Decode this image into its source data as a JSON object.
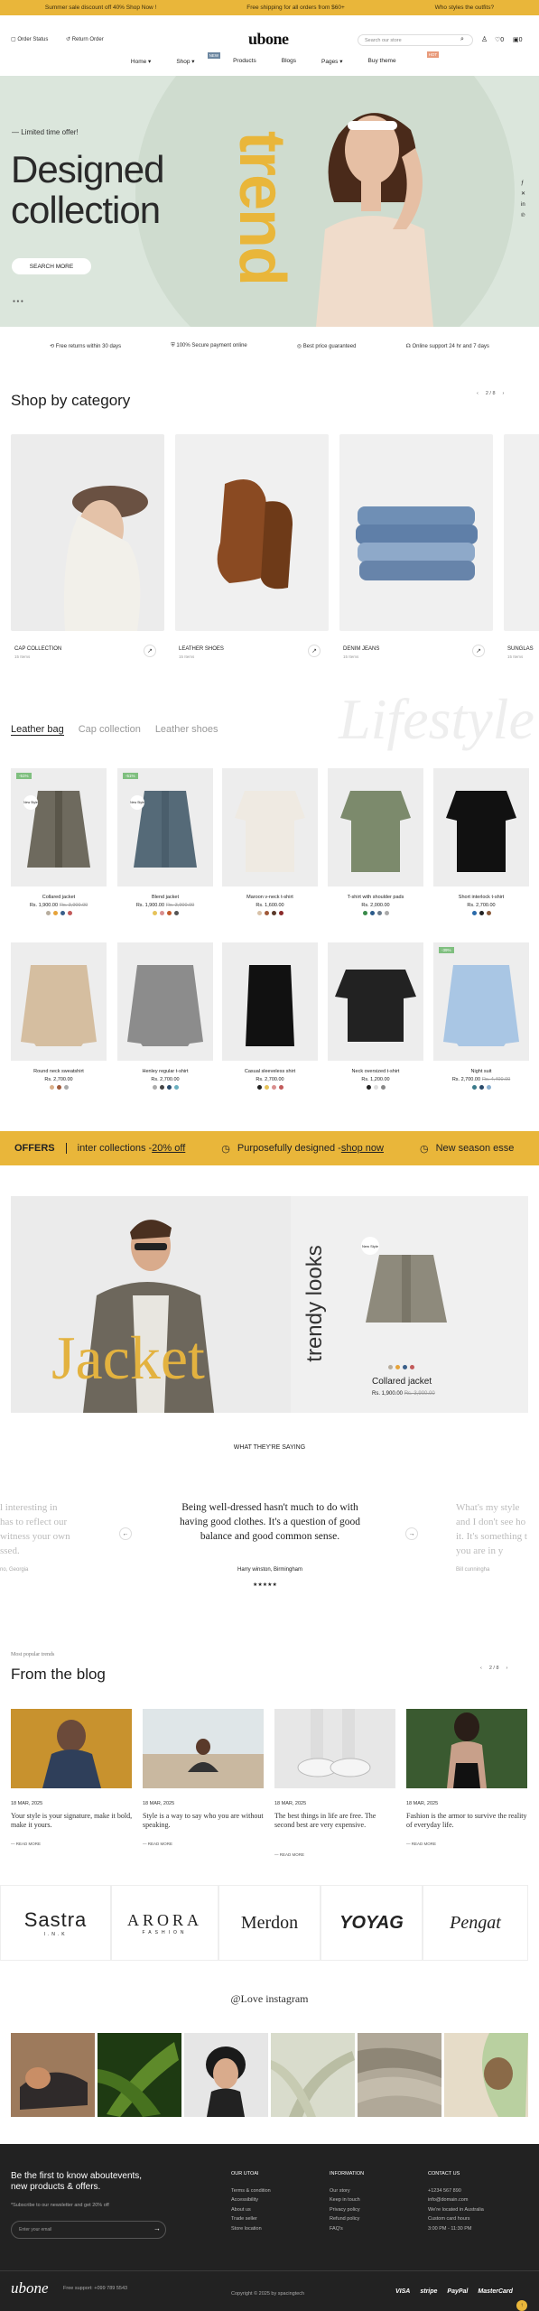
{
  "announcement": [
    "Summer sale discount off 40% Shop Now !",
    "Free shipping for all orders from $60+",
    "Who styles the outfits?"
  ],
  "header": {
    "order_status": "Order Status",
    "return_order": "Return Order",
    "logo": "ubone",
    "search_placeholder": "Search our store",
    "wish_count": "0",
    "cart_count": "0"
  },
  "nav": {
    "items": [
      "Home",
      "Shop",
      "Products",
      "Blogs",
      "Pages",
      "Buy theme"
    ],
    "shop_badge": "NEW",
    "buy_badge": "HOT"
  },
  "hero": {
    "kicker": "Limited time offer!",
    "title1": "Designed",
    "title2": "collection",
    "cta": "SEARCH MORE",
    "vertical": "trend"
  },
  "features": [
    "Free returns within 30 days",
    "100% Secure payment online",
    "Best price guaranteed",
    "Online support 24 hr and 7 days"
  ],
  "category": {
    "title": "Shop by category",
    "pager": "2 / 8",
    "items": [
      {
        "name": "CAP COLLECTION",
        "sub": "15 Items"
      },
      {
        "name": "LEATHER SHOES",
        "sub": "15 Items"
      },
      {
        "name": "DENIM JEANS",
        "sub": "15 Items"
      },
      {
        "name": "SUNGLAS",
        "sub": "15 Items"
      }
    ]
  },
  "tabs": {
    "items": [
      "Leather bag",
      "Cap collection",
      "Leather shoes"
    ],
    "bg_word": "Lifestyle"
  },
  "products": [
    {
      "name": "Collared jacket",
      "price": "Rs. 1,900.00",
      "old": "Rs. 3,900.00",
      "sale": "-51%",
      "badge": "New Style",
      "sw": [
        "#b7ad9e",
        "#e6a33a",
        "#3a5f8a",
        "#c25a5a"
      ]
    },
    {
      "name": "Blend jacket",
      "price": "Rs. 1,900.00",
      "old": "Rs. 3,900.00",
      "sale": "-51%",
      "badge": "New Style",
      "sw": [
        "#e6c35a",
        "#d98e8e",
        "#c25a2a",
        "#555"
      ]
    },
    {
      "name": "Maroon v-neck t-shirt",
      "price": "Rs. 1,600.00",
      "old": "",
      "sale": "",
      "badge": "",
      "sw": [
        "#d9c2a8",
        "#a05a3a",
        "#5a3a2a",
        "#8a2a2a"
      ]
    },
    {
      "name": "T-shirt with shoulder pads",
      "price": "Rs. 2,000.00",
      "old": "",
      "sale": "",
      "badge": "",
      "sw": [
        "#3a8a4a",
        "#2a5a8a",
        "#6a7a8a",
        "#aaa"
      ]
    },
    {
      "name": "Short interlock t-shirt",
      "price": "Rs. 2,700.00",
      "old": "",
      "sale": "",
      "badge": "",
      "sw": [
        "#2a6aaa",
        "#222",
        "#8a5a3a"
      ]
    },
    {
      "name": "Round neck sweatshirt",
      "price": "Rs. 2,700.00",
      "old": "",
      "sale": "",
      "badge": "",
      "sw": [
        "#d9b08a",
        "#a05a3a",
        "#aaa"
      ]
    },
    {
      "name": "Henley regular t-shirt",
      "price": "Rs. 2,700.00",
      "old": "",
      "sale": "",
      "badge": "",
      "sw": [
        "#aaa",
        "#444",
        "#2a4a6a",
        "#6ab0c0"
      ]
    },
    {
      "name": "Casual sleeveless shirt",
      "price": "Rs. 2,700.00",
      "old": "",
      "sale": "",
      "badge": "",
      "sw": [
        "#222",
        "#e6c35a",
        "#d98e8e",
        "#c25a5a"
      ]
    },
    {
      "name": "Neck oversized t-shirt",
      "price": "Rs. 1,200.00",
      "old": "",
      "sale": "",
      "badge": "",
      "sw": [
        "#222",
        "#ddd",
        "#888"
      ]
    },
    {
      "name": "Night suit",
      "price": "Rs. 2,700.00",
      "old": "Rs. 4,400.00",
      "sale": "-39%",
      "badge": "",
      "sw": [
        "#3a7a8a",
        "#2a4a6a",
        "#8ab0d0"
      ]
    }
  ],
  "marquee": {
    "offers": "OFFERS",
    "t1": "inter collections - ",
    "l1": "20% off",
    "t2": "Purposefully designed - ",
    "l2": "shop now",
    "t3": "New season esse"
  },
  "banner": {
    "jacket": "Jacket",
    "vertical": "trendy looks",
    "badge": "New Style",
    "name": "Collared jacket",
    "price": "Rs. 1,900.00",
    "old": "Rs. 3,900.00",
    "sw": [
      "#b7ad9e",
      "#e6a33a",
      "#3a5f8a",
      "#c25a5a"
    ]
  },
  "testimonial": {
    "heading": "WHAT THEY'RE SAYING",
    "left": [
      "l interesting in",
      "has to reflect our",
      "witness your own",
      "ssed."
    ],
    "left_author": "no, Georgia",
    "center": "Being well-dressed hasn't much to do with having good clothes. It's a question of good balance and good common sense.",
    "author": "Harry winston, Birmingham",
    "right": [
      "What's my style",
      "and I don't see ho",
      "it. It's something t",
      "you are in y"
    ],
    "right_author": "Bill cunningha"
  },
  "blog": {
    "kicker": "Most popular trends",
    "title": "From the blog",
    "pager": "2 / 8",
    "posts": [
      {
        "date": "18 MAR, 2025",
        "title": "Your style is your signature, make it bold, make it yours.",
        "more": "READ MORE"
      },
      {
        "date": "18 MAR, 2025",
        "title": "Style is a way to say who you are without speaking.",
        "more": "READ MORE"
      },
      {
        "date": "18 MAR, 2025",
        "title": "The best things in life are free. The second best are very expensive.",
        "more": "READ MORE"
      },
      {
        "date": "18 MAR, 2025",
        "title": "Fashion is the armor to survive the reality of everyday life.",
        "more": "READ MORE"
      }
    ]
  },
  "brands": [
    "Sastra",
    "ARORA",
    "Merdon",
    "YOYAG",
    "Pengat"
  ],
  "brand_subs": [
    "I.N.K",
    "FASHION"
  ],
  "instagram": {
    "title": "@Love instagram"
  },
  "footer": {
    "news1": "Be the first to know aboutevents,",
    "news2": "new products & offers.",
    "news_sub": "*Subscribe to our newsletter and get 20% off",
    "email_placeholder": "Enter your email",
    "cols": [
      {
        "title": "OUR UTOAI",
        "items": [
          "Terms & condition",
          "Accessibility",
          "About us",
          "Trade seller",
          "Store location"
        ]
      },
      {
        "title": "INFORMATION",
        "items": [
          "Our story",
          "Keep in touch",
          "Privacy policy",
          "Refund policy",
          "FAQ's"
        ]
      },
      {
        "title": "CONTACT US",
        "items": [
          "+1234 567 890",
          "info@domain.com",
          "We're located in Australia",
          "Custom card hours",
          "3:00 PM - 11:30 PM"
        ]
      }
    ],
    "logo": "ubone",
    "support": "Free support: +099 789 5543",
    "copyright": "Copyright © 2025 by spacingtech",
    "pay": [
      "VISA",
      "stripe",
      "PayPal",
      "MasterCard"
    ]
  }
}
